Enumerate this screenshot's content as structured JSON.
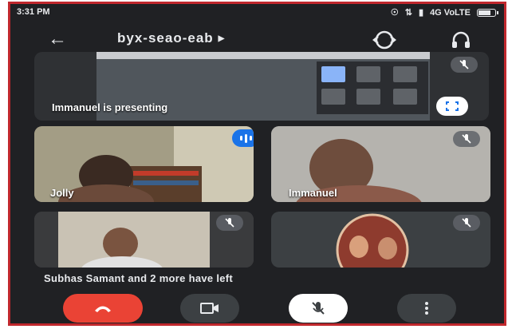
{
  "status_bar": {
    "time": "3:31 PM",
    "network": "4G VoLTE",
    "battery_level": 0.8
  },
  "header": {
    "meeting_code": "byx-seao-eab"
  },
  "presentation": {
    "label": "Immanuel is presenting"
  },
  "participants": [
    {
      "name": "Jolly",
      "speaking": true
    },
    {
      "name": "Immanuel",
      "muted": true
    }
  ],
  "notice": "Subhas Samant and 2 more have left",
  "colors": {
    "background": "#202124",
    "tile": "#3c4043",
    "end_call": "#ea4335",
    "speaking": "#1a73e8"
  }
}
